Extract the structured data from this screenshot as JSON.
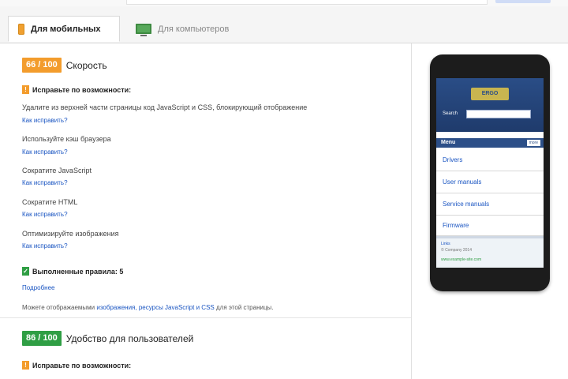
{
  "tabs": [
    {
      "label": "Для мобильных",
      "icon": "mobile-icon",
      "active": true
    },
    {
      "label": "Для компьютеров",
      "icon": "desktop-icon",
      "active": false
    }
  ],
  "speed": {
    "score": "66 / 100",
    "title": "Скорость",
    "section_title": "Исправьте по возможности:",
    "items": [
      {
        "title": "Удалите из верхней части страницы код JavaScript и CSS, блокирующий отображение",
        "link": "Как исправить?"
      },
      {
        "title": "Используйте кэш браузера",
        "link": "Как исправить?"
      },
      {
        "title": "Сократите JavaScript",
        "link": "Как исправить?"
      },
      {
        "title": "Сократите HTML",
        "link": "Как исправить?"
      },
      {
        "title": "Оптимизируйте изображения",
        "link": "Как исправить?"
      }
    ],
    "passed_title": "Выполненные правила: 5",
    "passed_link": "Подробнее",
    "note_prefix": "Можете отображаемыми",
    "note_link": "изображения, ресурсы JavaScript и CSS",
    "note_suffix": "для этой страницы."
  },
  "usability": {
    "score": "86 / 100",
    "title": "Удобство для пользователей",
    "section_title": "Исправьте по возможности:"
  },
  "phone_preview": {
    "logo": "ERGO",
    "search_label": "Search",
    "search_placeholder": "",
    "menu_title": "Menu",
    "menu_more": "more",
    "menu_items": [
      "Drivers",
      "User manuals",
      "Service manuals",
      "Firmware"
    ],
    "footer_title": "Links",
    "footer_text": "© Company 2014",
    "footer_link": "www.example-site.com"
  },
  "colors": {
    "accent_orange": "#f39c2c",
    "accent_green": "#2f9e44",
    "link_blue": "#1a55c2"
  }
}
